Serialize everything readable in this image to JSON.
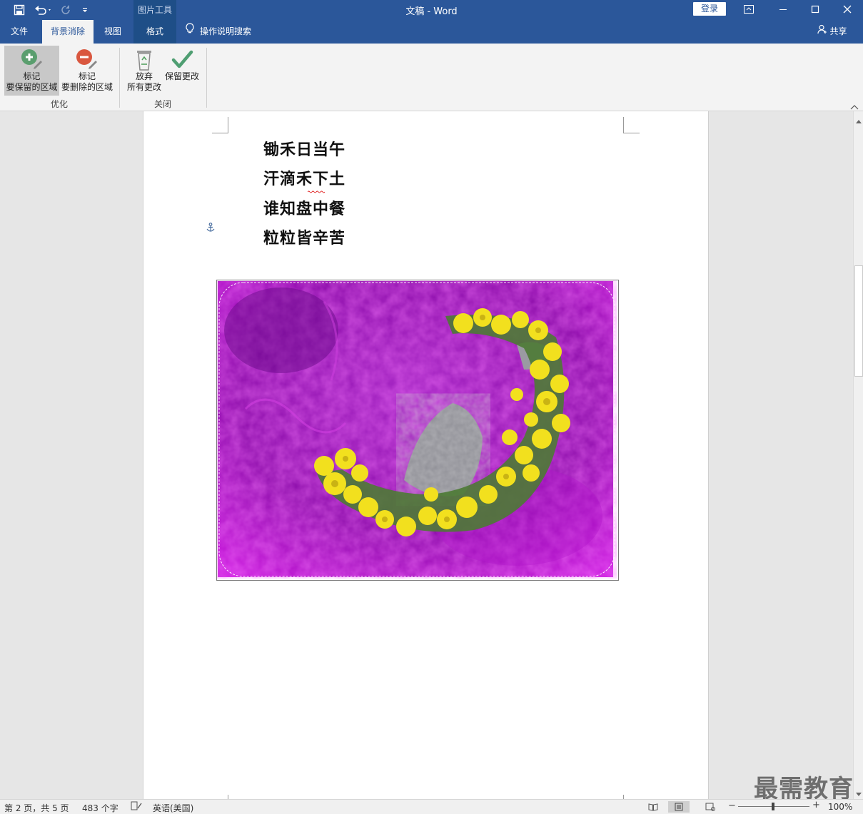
{
  "app": {
    "doc_title": "文稿 - Word",
    "context_group": "图片工具",
    "login_label": "登录"
  },
  "tabs": [
    {
      "label": "文件"
    },
    {
      "label": "背景消除"
    },
    {
      "label": "视图"
    },
    {
      "label": "格式"
    }
  ],
  "search": {
    "label": "操作说明搜索"
  },
  "share": {
    "label": "共享"
  },
  "ribbon": {
    "mark_keep": {
      "line1": "标记",
      "line2": "要保留的区域"
    },
    "mark_remove": {
      "line1": "标记",
      "line2": "要删除的区域"
    },
    "group_optimize": "优化",
    "discard": {
      "line1": "放弃",
      "line2": "所有更改"
    },
    "keep_changes": "保留更改",
    "group_close": "关闭"
  },
  "document": {
    "poem": [
      "锄禾日当午",
      "汗滴禾下土",
      "谁知盘中餐",
      "粒粒皆辛苦"
    ]
  },
  "status": {
    "page": "第 2 页，共 5 页",
    "words": "483 个字",
    "language": "英语(美国)",
    "zoom": "100%"
  },
  "watermark": "最需教育",
  "colors": {
    "brand": "#2b579a",
    "removal_tint": "#a000b8",
    "flower": "#f2e01e"
  }
}
